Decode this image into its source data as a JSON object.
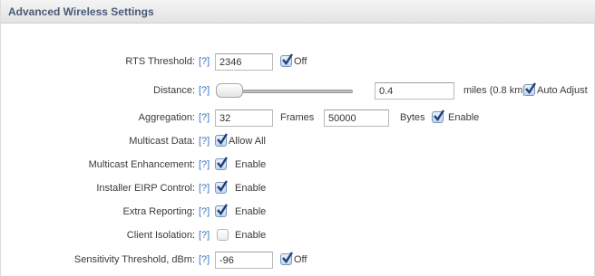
{
  "panel": {
    "title": "Advanced Wireless Settings"
  },
  "help_text": "[?]",
  "rts": {
    "label": "RTS Threshold:",
    "value": "2346",
    "off_label": "Off",
    "off_checked": true
  },
  "distance": {
    "label": "Distance:",
    "slider_level": 0.0,
    "value": "0.4",
    "unit_text": "miles (0.8 km)",
    "auto_label": "Auto Adjust",
    "auto_checked": true
  },
  "aggregation": {
    "label": "Aggregation:",
    "frames_value": "32",
    "frames_label": "Frames",
    "bytes_value": "50000",
    "bytes_label": "Bytes",
    "enable_label": "Enable",
    "enable_checked": true
  },
  "multicast_data": {
    "label": "Multicast Data:",
    "allow_label": "Allow All",
    "checked": true
  },
  "multicast_enh": {
    "label": "Multicast Enhancement:",
    "enable_label": "Enable",
    "checked": true
  },
  "installer_eirp": {
    "label": "Installer EIRP Control:",
    "enable_label": "Enable",
    "checked": true
  },
  "extra_reporting": {
    "label": "Extra Reporting:",
    "enable_label": "Enable",
    "checked": true
  },
  "client_isolation": {
    "label": "Client Isolation:",
    "enable_label": "Enable",
    "checked": false
  },
  "sensitivity": {
    "label": "Sensitivity Threshold, dBm:",
    "value": "-96",
    "off_label": "Off",
    "off_checked": true
  },
  "colors": {
    "header_text": "#4a5a78",
    "help_link": "#3b74c2",
    "check_mark": "#1f3f7a"
  }
}
